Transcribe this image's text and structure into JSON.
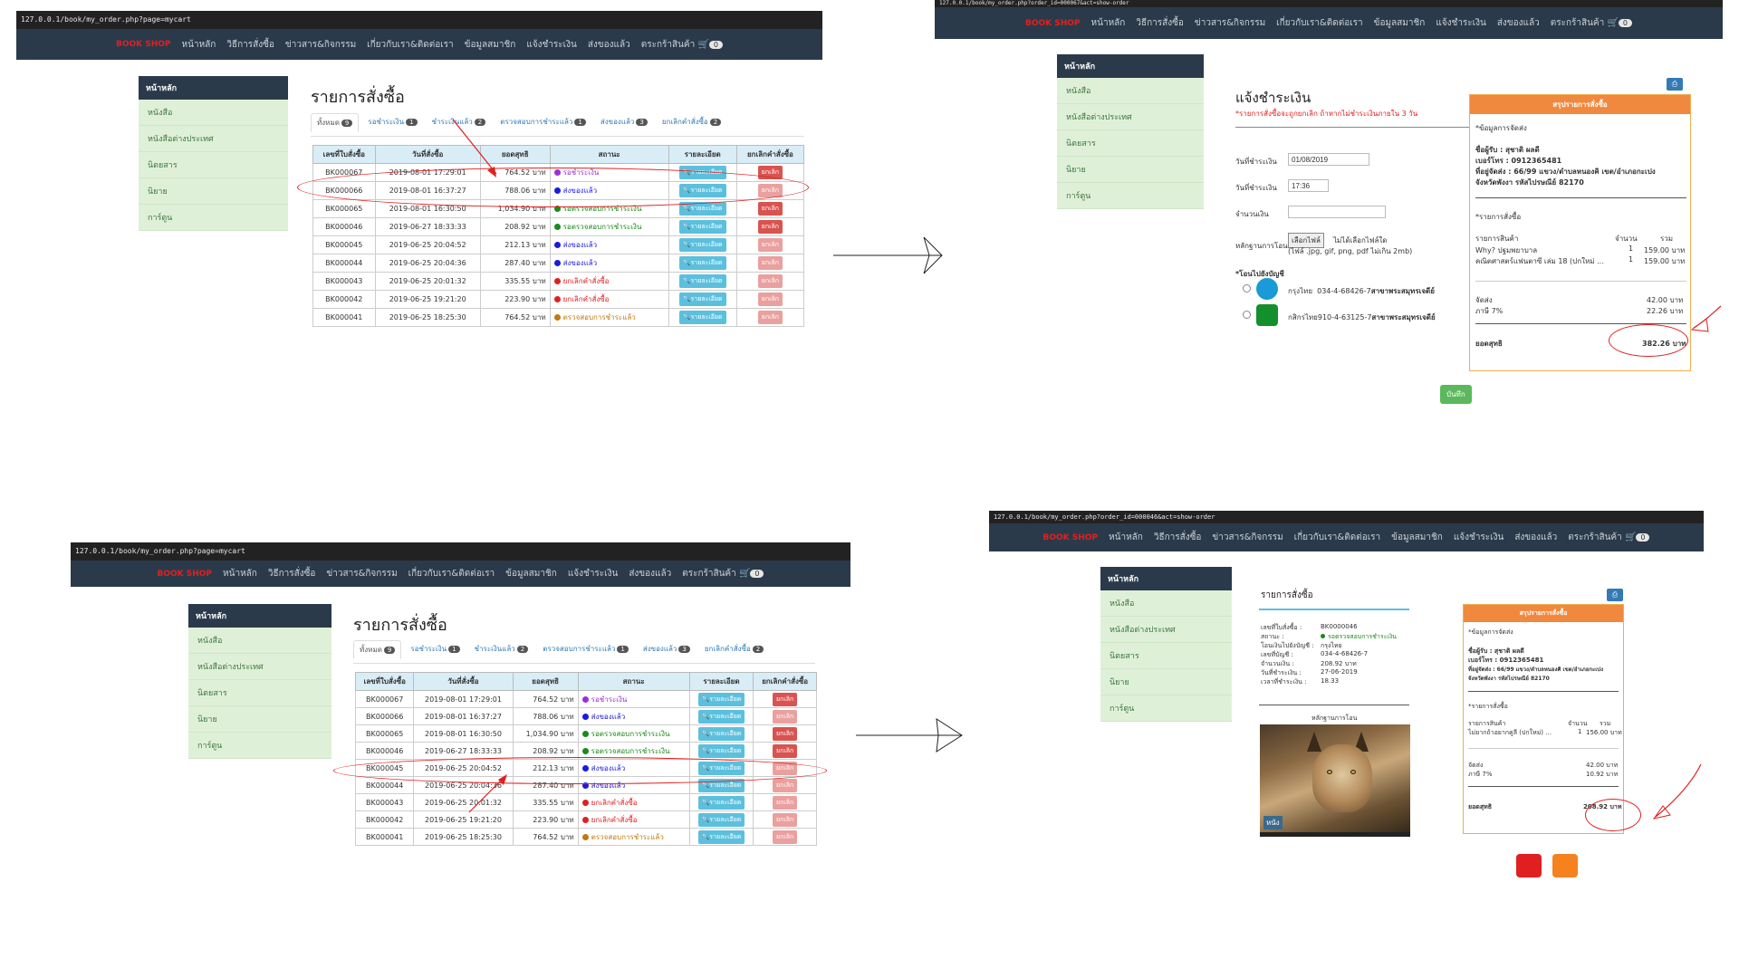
{
  "nav": {
    "brand": "BOOK SHOP",
    "items": [
      "หน้าหลัก",
      "วิธีการสั่งซื้อ",
      "ข่าวสาร&กิจกรรม",
      "เกี่ยวกับเรา&ติดต่อเรา",
      "ข้อมูลสมาชิก",
      "แจ้งชำระเงิน",
      "ส่งของแล้ว",
      "ตระกร้าสินค้า"
    ],
    "cart_count": "0"
  },
  "urls": {
    "p1": "127.0.0.1/book/my_order.php?page=mycart",
    "p2": "127.0.0.1/book/my_order.php?order_id=000067&act=show-order",
    "p3": "127.0.0.1/book/my_order.php?page=mycart",
    "p4": "127.0.0.1/book/my_order.php?order_id=000046&act=show-order"
  },
  "sidebar": {
    "head": "หน้าหลัก",
    "items": [
      "หนังสือ",
      "หนังสือต่างประเทศ",
      "นิตยสาร",
      "นิยาย",
      "การ์ตูน"
    ]
  },
  "orders_page": {
    "title": "รายการสั่งซื้อ",
    "tabs": [
      {
        "label": "ทั้งหมด",
        "count": "9"
      },
      {
        "label": "รอชำระเงิน",
        "count": "1"
      },
      {
        "label": "ชำระเงินแล้ว",
        "count": "2"
      },
      {
        "label": "ตรวจสอบการชำระแล้ว",
        "count": "1"
      },
      {
        "label": "ส่งของแล้ว",
        "count": "3"
      },
      {
        "label": "ยกเลิกคำสั่งซื้อ",
        "count": "2"
      }
    ],
    "headers": [
      "เลขที่ใบสั่งซื้อ",
      "วันที่สั่งซื้อ",
      "ยอดสุทธิ",
      "สถานะ",
      "รายละเอียด",
      "ยกเลิกคำสั่งซื้อ"
    ],
    "detail_label": "รายละเอียด",
    "cancel_label": "ยกเลิก",
    "rows": [
      {
        "id": "BK000067",
        "date": "2019-08-01 17:29:01",
        "amount": "764.52 บาท",
        "status": "รอชำระเงิน",
        "color": "#9b30d9",
        "cancel_enabled": true
      },
      {
        "id": "BK000066",
        "date": "2019-08-01 16:37:27",
        "amount": "788.06 บาท",
        "status": "ส่งของแล้ว",
        "color": "#1a1ae0",
        "cancel_enabled": false
      },
      {
        "id": "BK000065",
        "date": "2019-08-01 16:30:50",
        "amount": "1,034.90 บาท",
        "status": "รอตรวจสอบการชำระเงิน",
        "color": "#1a8a1a",
        "cancel_enabled": true
      },
      {
        "id": "BK000046",
        "date": "2019-06-27 18:33:33",
        "amount": "208.92 บาท",
        "status": "รอตรวจสอบการชำระเงิน",
        "color": "#1a8a1a",
        "cancel_enabled": true
      },
      {
        "id": "BK000045",
        "date": "2019-06-25 20:04:52",
        "amount": "212.13 บาท",
        "status": "ส่งของแล้ว",
        "color": "#1a1ae0",
        "cancel_enabled": false
      },
      {
        "id": "BK000044",
        "date": "2019-06-25 20:04:36",
        "amount": "287.40 บาท",
        "status": "ส่งของแล้ว",
        "color": "#1a1ae0",
        "cancel_enabled": false
      },
      {
        "id": "BK000043",
        "date": "2019-06-25 20:01:32",
        "amount": "335.55 บาท",
        "status": "ยกเลิกคำสั่งซื้อ",
        "color": "#e02020",
        "cancel_enabled": false
      },
      {
        "id": "BK000042",
        "date": "2019-06-25 19:21:20",
        "amount": "223.90 บาท",
        "status": "ยกเลิกคำสั่งซื้อ",
        "color": "#e02020",
        "cancel_enabled": false
      },
      {
        "id": "BK000041",
        "date": "2019-06-25 18:25:30",
        "amount": "764.52 บาท",
        "status": "ตรวจสอบการชำระแล้ว",
        "color": "#c07a10",
        "cancel_enabled": false
      }
    ]
  },
  "payment": {
    "title": "แจ้งชำระเงิน",
    "note": "*รายการสั่งซื้อจะถูกยกเลิก ถ้าหากไม่ชำระเงินภายใน 3 วัน",
    "date_label": "วันที่ชำระเงิน",
    "date_value": "01/08/2019",
    "time_label": "วันที่ชำระเงิน",
    "time_value": "17:36",
    "amount_label": "จำนวนเงิน",
    "proof_label": "หลักฐานการโอน",
    "file_button": "เลือกไฟล์",
    "file_status": "ไม่ได้เลือกไฟล์ใด",
    "file_hint": "(ไฟล์ .jpg, gif, png, pdf ไม่เกิน 2mb)",
    "bank_title": "*โอนไปยังบัญชี",
    "banks": [
      {
        "name": "กรุงไทย",
        "account": "034-4-68426-7",
        "branch": "สาขาพระสมุทรเจดีย์",
        "color": "#1a9ad6"
      },
      {
        "name": "กสิกรไทย",
        "account": "910-4-63125-7",
        "branch": "สาขาพระสมุทรเจดีย์",
        "color": "#138f2d"
      }
    ],
    "save_label": "บันทึก"
  },
  "summary1": {
    "head": "สรุปรายการสั่งซื้อ",
    "ship_title": "*ข้อมูลการจัดส่ง",
    "receiver": "ชื่อผู้รับ : สุชาติ ผลดี",
    "phone": "เบอร์โทร : 0912365481",
    "addr1": "ที่อยู่จัดส่ง : 66/99 แขวง/ตำบลหนองคิ เขต/อำเภอกะเปง",
    "addr2": "จังหวัดพังงา รหัสไปรษณีย์ 82170",
    "items_title": "*รายการสั่งซื้อ",
    "col_item": "รายการสินค้า",
    "col_qty": "จำนวน",
    "col_total": "รวม",
    "items": [
      {
        "name": "Why? ปฐมพยาบาล",
        "qty": "1",
        "total": "159.00 บาท"
      },
      {
        "name": "คณิตศาสตร์แฟนตาซี เล่ม 18 (ปกใหม่ ...",
        "qty": "1",
        "total": "159.00 บาท"
      }
    ],
    "ship_label": "จัดส่ง",
    "ship_value": "42.00 บาท",
    "vat_label": "ภาษี 7%",
    "vat_value": "22.26 บาท",
    "net_label": "ยอดสุทธิ",
    "net_value": "382.26 บาท"
  },
  "order_detail": {
    "title": "รายการสั่งซื้อ",
    "fields": [
      {
        "label": "เลขที่ใบสั่งซื้อ :",
        "value": "BK0000046"
      },
      {
        "label": "สถานะ :",
        "value": "รอตรวจสอบการชำระเงิน"
      },
      {
        "label": "โอนเงินไปยังบัญชี :",
        "value": "กรุงไทย"
      },
      {
        "label": "เลขที่บัญชี :",
        "value": "034-4-68426-7"
      },
      {
        "label": "จำนวนเงิน :",
        "value": "208.92 บาท"
      },
      {
        "label": "วันที่ชำระเงิน :",
        "value": "27-06-2019"
      },
      {
        "label": "เวลาที่ชำระเงิน :",
        "value": "18.33"
      }
    ],
    "proof_title": "หลักฐานการโอน",
    "img_tag": "หนัง"
  },
  "summary2": {
    "head": "สรุปรายการสั่งซื้อ",
    "ship_title": "*ข้อมูลการจัดส่ง",
    "receiver": "ชื่อผู้รับ : สุชาติ ผลดี",
    "phone": "เบอร์โทร : 0912365481",
    "addr1": "ที่อยู่จัดส่ง : 66/99 แขวง/ตำบลหนองคิ เขต/อำเภอกะเปง",
    "addr2": "จังหวัดพังงา รหัสไปรษณีย์ 82170",
    "items_title": "*รายการสั่งซื้อ",
    "col_item": "รายการสินค้า",
    "col_qty": "จำนวน",
    "col_total": "รวม",
    "items": [
      {
        "name": "ไม่ยากถ้าอยากคูลี (ปกใหม่) ...",
        "qty": "1",
        "total": "156.00 บาท"
      }
    ],
    "ship_label": "จัดส่ง",
    "ship_value": "42.00 บาท",
    "vat_label": "ภาษี 7%",
    "vat_value": "10.92 บาท",
    "net_label": "ยอดสุทธิ",
    "net_value": "208.92 บาท"
  },
  "colors": {
    "navbar": "#2b3a4a",
    "annotation": "#e02020",
    "summary_head": "#f0883e",
    "sidebar": "#dff0d8"
  }
}
